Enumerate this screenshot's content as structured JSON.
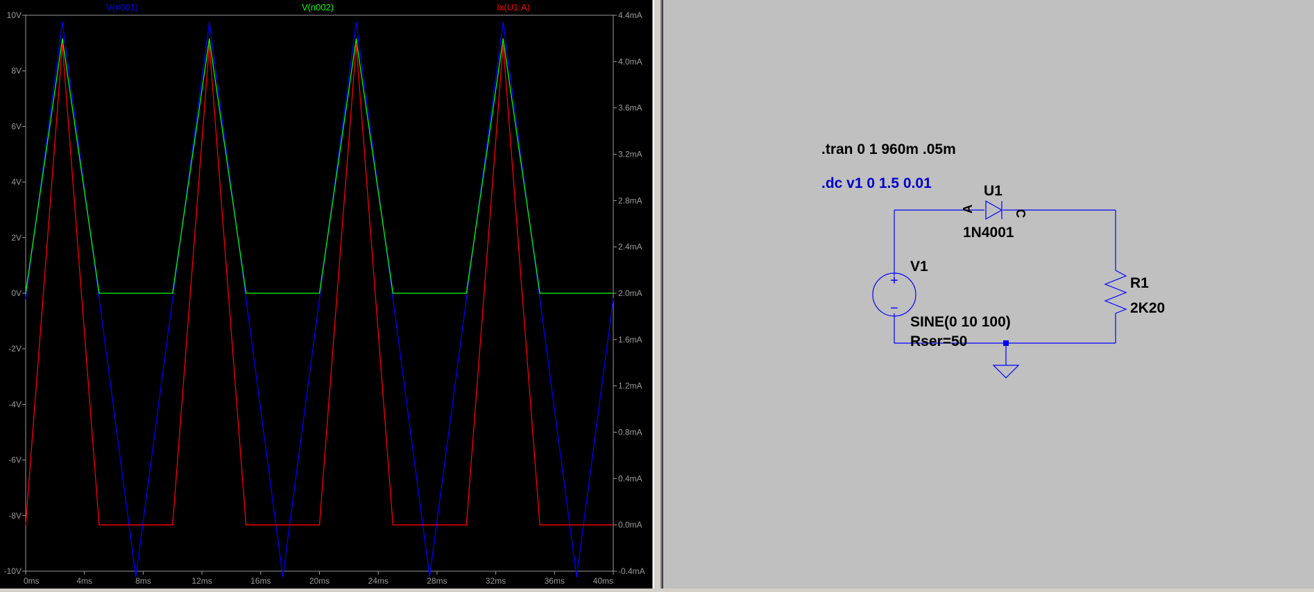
{
  "waveform": {
    "traces": [
      {
        "label": "V(n001)",
        "color": "#0000ff"
      },
      {
        "label": "V(n002)",
        "color": "#00ff00"
      },
      {
        "label": "Ix(U1:A)",
        "color": "#ff0000"
      }
    ],
    "left_axis_ticks": [
      "10V",
      "8V",
      "6V",
      "4V",
      "2V",
      "0V",
      "-2V",
      "-4V",
      "-6V",
      "-8V",
      "-10V"
    ],
    "right_axis_ticks": [
      "4.4mA",
      "4.0mA",
      "3.6mA",
      "3.2mA",
      "2.8mA",
      "2.4mA",
      "2.0mA",
      "1.6mA",
      "1.2mA",
      "0.8mA",
      "0.4mA",
      "0.0mA",
      "-0.4mA"
    ],
    "x_axis_ticks": [
      "0ms",
      "4ms",
      "8ms",
      "12ms",
      "16ms",
      "20ms",
      "24ms",
      "28ms",
      "32ms",
      "36ms",
      "40ms"
    ]
  },
  "chart_data": {
    "type": "line",
    "xlabel": "",
    "ylabel": "",
    "x_unit": "ms",
    "xlim": [
      0,
      40
    ],
    "ylim": [
      -10,
      10
    ],
    "y2lim": [
      -0.4,
      4.4
    ],
    "grid": false,
    "legend_position": "top",
    "series": [
      {
        "name": "V(n001)",
        "axis": "left",
        "unit": "V",
        "color": "#0000ff",
        "x": [
          0,
          2.5,
          5,
          7.5,
          10,
          12.5,
          15,
          17.5,
          20,
          22.5,
          25,
          27.5,
          30,
          32.5,
          35,
          37.5,
          40
        ],
        "y": [
          -0.2,
          9.75,
          -0.2,
          -10.2,
          -0.2,
          9.75,
          -0.2,
          -10.2,
          -0.2,
          9.75,
          -0.2,
          -10.2,
          -0.2,
          9.75,
          -0.2,
          -10.2,
          -0.2
        ]
      },
      {
        "name": "V(n002)",
        "axis": "left",
        "unit": "V",
        "color": "#00ff00",
        "x": [
          0,
          2.5,
          5,
          10,
          12.5,
          15,
          20,
          22.5,
          25,
          30,
          32.5,
          35,
          40
        ],
        "y": [
          0,
          9.15,
          0,
          0,
          9.15,
          0,
          0,
          9.15,
          0,
          0,
          9.15,
          0,
          0
        ]
      },
      {
        "name": "Ix(U1:A)",
        "axis": "right",
        "unit": "mA",
        "color": "#ff0000",
        "x": [
          0,
          2.5,
          5,
          10,
          12.5,
          15,
          20,
          22.5,
          25,
          30,
          32.5,
          35,
          40
        ],
        "y": [
          0,
          4.15,
          0,
          0,
          4.15,
          0,
          0,
          4.15,
          0,
          0,
          4.15,
          0,
          0
        ]
      }
    ]
  },
  "schematic": {
    "tran_directive": ".tran 0 1 960m .05m",
    "dc_directive": ".dc v1 0 1.5 0.01",
    "diode": {
      "ref": "U1",
      "model": "1N4001",
      "pin_a": "A",
      "pin_c": "C"
    },
    "source": {
      "ref": "V1",
      "value": "SINE(0 10 100)",
      "param": "Rser=50",
      "plus": "+",
      "minus": "−"
    },
    "resistor": {
      "ref": "R1",
      "value": "2K20"
    },
    "colors": {
      "wire": "#0000ff",
      "dc_text": "#0000c8",
      "background": "#c0c0c0"
    }
  }
}
